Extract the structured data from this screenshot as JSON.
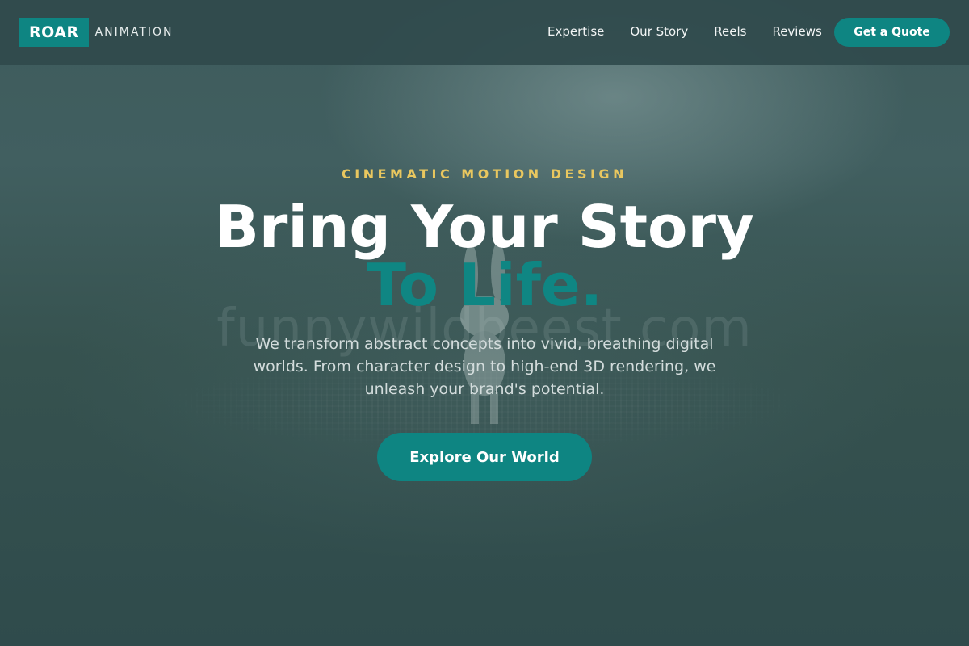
{
  "brand": {
    "badge": "ROAR",
    "wordmark": "ANIMATION",
    "accent_color": "#0e8582"
  },
  "nav": {
    "links": [
      "Expertise",
      "Our Story",
      "Reels",
      "Reviews"
    ],
    "cta_label": "Get a Quote"
  },
  "hero": {
    "eyebrow": "CINEMATIC MOTION DESIGN",
    "headline_line1": "Bring Your Story",
    "headline_line2": "To Life.",
    "description": "We transform abstract concepts into vivid, breathing digital worlds. From character design to high-end 3D rendering, we unleash your brand's potential.",
    "cta_label": "Explore Our World",
    "watermark": "funnywildbeest.com",
    "eyebrow_color": "#e9c75f",
    "headline_accent_color": "#0f8683"
  }
}
